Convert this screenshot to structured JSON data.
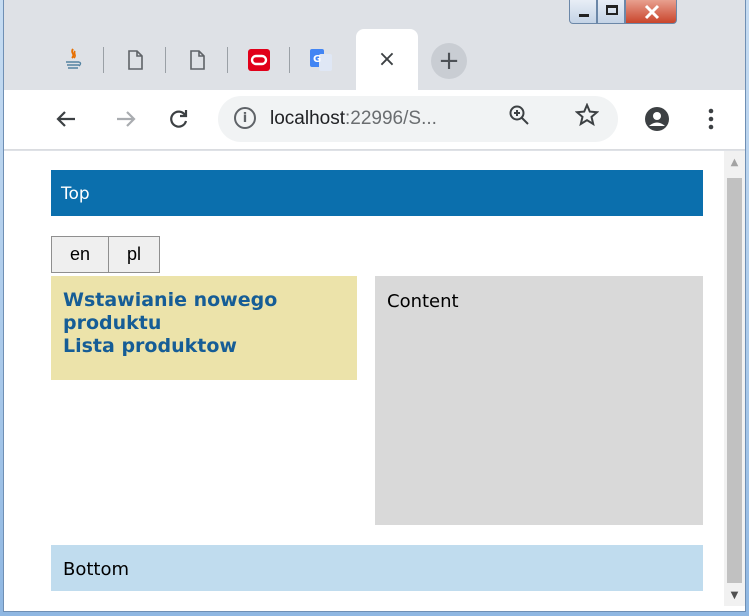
{
  "browser": {
    "tabs": [
      {
        "icon": "java-icon"
      },
      {
        "icon": "page-icon"
      },
      {
        "icon": "page-icon"
      },
      {
        "icon": "oracle-icon"
      },
      {
        "icon": "translate-icon"
      }
    ],
    "active_tab_close": "×",
    "new_tab": "+",
    "address": {
      "host": "localhost",
      "rest": ":22996/S..."
    }
  },
  "page": {
    "top": "Top",
    "languages": [
      {
        "label": "en"
      },
      {
        "label": "pl"
      }
    ],
    "nav": [
      {
        "label": "Wstawianie nowego produktu"
      },
      {
        "label": "Lista produktow"
      }
    ],
    "content": "Content",
    "bottom": "Bottom"
  },
  "colors": {
    "top_bar": "#0b6fad",
    "nav_bg": "#ece3aa",
    "nav_link": "#165d96",
    "content_bg": "#d9d9d9",
    "bottom_bar": "#c0dcee"
  }
}
